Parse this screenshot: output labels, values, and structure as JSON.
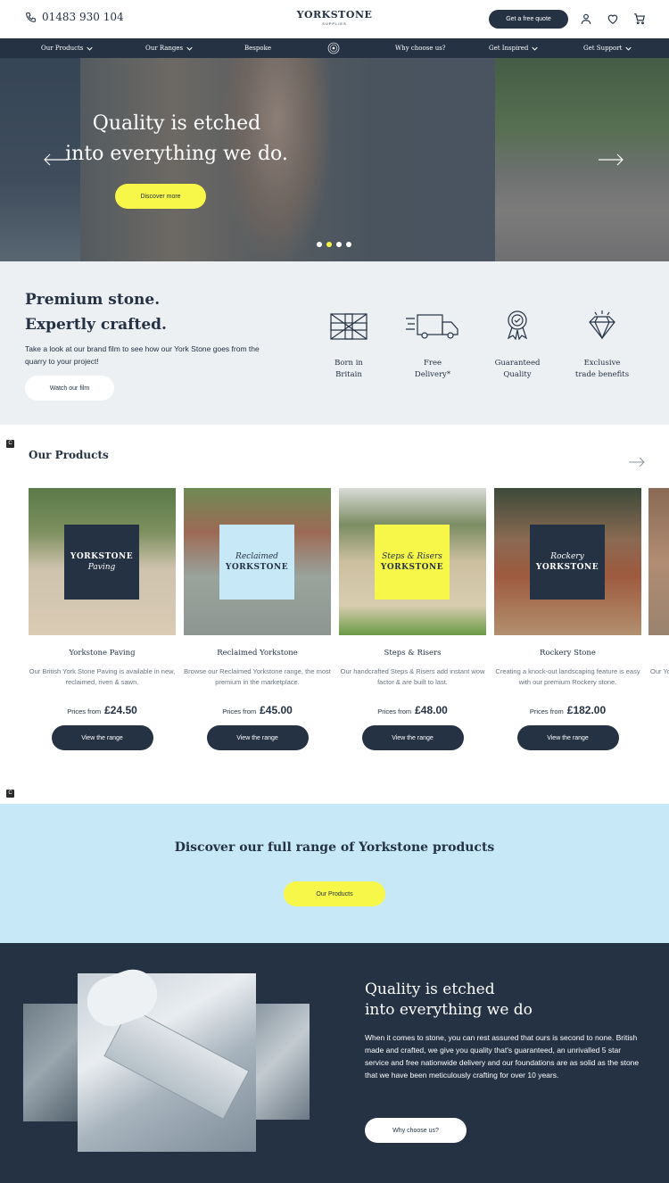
{
  "header": {
    "phone": "01483 930 104",
    "logo_main": "YORKSTONE",
    "logo_sub": "SUPPLIES",
    "quote_button": "Get a free quote",
    "icons": [
      "phone-icon",
      "account-icon",
      "wishlist-heart-icon",
      "cart-icon"
    ]
  },
  "nav": {
    "items": [
      {
        "label": "Our Products",
        "dropdown": true
      },
      {
        "label": "Our Ranges",
        "dropdown": true
      },
      {
        "label": "Bespoke",
        "dropdown": false
      },
      {
        "label": "Why choose us?",
        "dropdown": false
      },
      {
        "label": "Get Inspired",
        "dropdown": true
      },
      {
        "label": "Get Support",
        "dropdown": true
      }
    ]
  },
  "hero": {
    "title_line1": "Quality is etched",
    "title_line2": "into everything we do.",
    "button": "Discover more",
    "slides": 4,
    "active_slide": 2
  },
  "premium": {
    "title_line1": "Premium stone.",
    "title_line2": "Expertly crafted.",
    "text": "Take a look at our brand film to see how our York Stone goes from the quarry to your project!",
    "button": "Watch our film",
    "features": [
      {
        "icon": "union-flag-icon",
        "line1": "Born in",
        "line2": "Britain"
      },
      {
        "icon": "delivery-truck-icon",
        "line1": "Free",
        "line2": "Delivery*"
      },
      {
        "icon": "award-rosette-icon",
        "line1": "Guaranteed",
        "line2": "Quality"
      },
      {
        "icon": "diamond-icon",
        "line1": "Exclusive",
        "line2": "trade benefits"
      }
    ]
  },
  "products": {
    "title": "Our Products",
    "items": [
      {
        "name": "Yorkstone Paving",
        "box_line1": "YORKSTONE",
        "box_line2": "Paving",
        "box_color": "#243244",
        "box_text_color": "#ffffff",
        "description": "Our British York Stone Paving is available in new, reclaimed, riven & sawn.",
        "price_label": "Prices from",
        "price": "£24.50",
        "button": "View the range"
      },
      {
        "name": "Reclaimed Yorkstone",
        "box_line1": "Reclaimed",
        "box_line2": "YORKSTONE",
        "box_color": "#c7e8f7",
        "box_text_color": "#243244",
        "description": "Browse our Reclaimed Yorkstone range, the most premium in the marketplace.",
        "price_label": "Prices from",
        "price": "£45.00",
        "button": "View the range"
      },
      {
        "name": "Steps & Risers",
        "box_line1": "Steps & Risers",
        "box_line2": "YORKSTONE",
        "box_color": "#f7f74a",
        "box_text_color": "#243244",
        "description": "Our handcrafted Steps & Risers add instant wow factor & are built to last.",
        "price_label": "Prices from",
        "price": "£48.00",
        "button": "View the range"
      },
      {
        "name": "Rockery Stone",
        "box_line1": "Rockery",
        "box_line2": "YORKSTONE",
        "box_color": "#243244",
        "box_text_color": "#ffffff",
        "description": "Creating a knock-out landscaping feature is easy with our premium Rockery stone.",
        "price_label": "Prices from",
        "price": "£182.00",
        "button": "View the range"
      }
    ],
    "partial_card_text": "Our Yo"
  },
  "discover": {
    "title": "Discover our full range of Yorkstone products",
    "button": "Our Products"
  },
  "quality": {
    "title_line1": "Quality is etched",
    "title_line2": "into everything we do",
    "text": "When it comes to stone, you can rest assured that ours is second to none. British made and crafted, we give you quality that's guaranteed, an unrivalled 5 star service and free nationwide delivery and our foundations are as solid as the stone that we have been meticulously crafting for over 10 years.",
    "button": "Why choose us?"
  },
  "widget_badge": "C",
  "colors": {
    "navy": "#243244",
    "yellow": "#f7f74a",
    "light_blue": "#c7e8f7",
    "light_grey": "#edf0f3"
  }
}
